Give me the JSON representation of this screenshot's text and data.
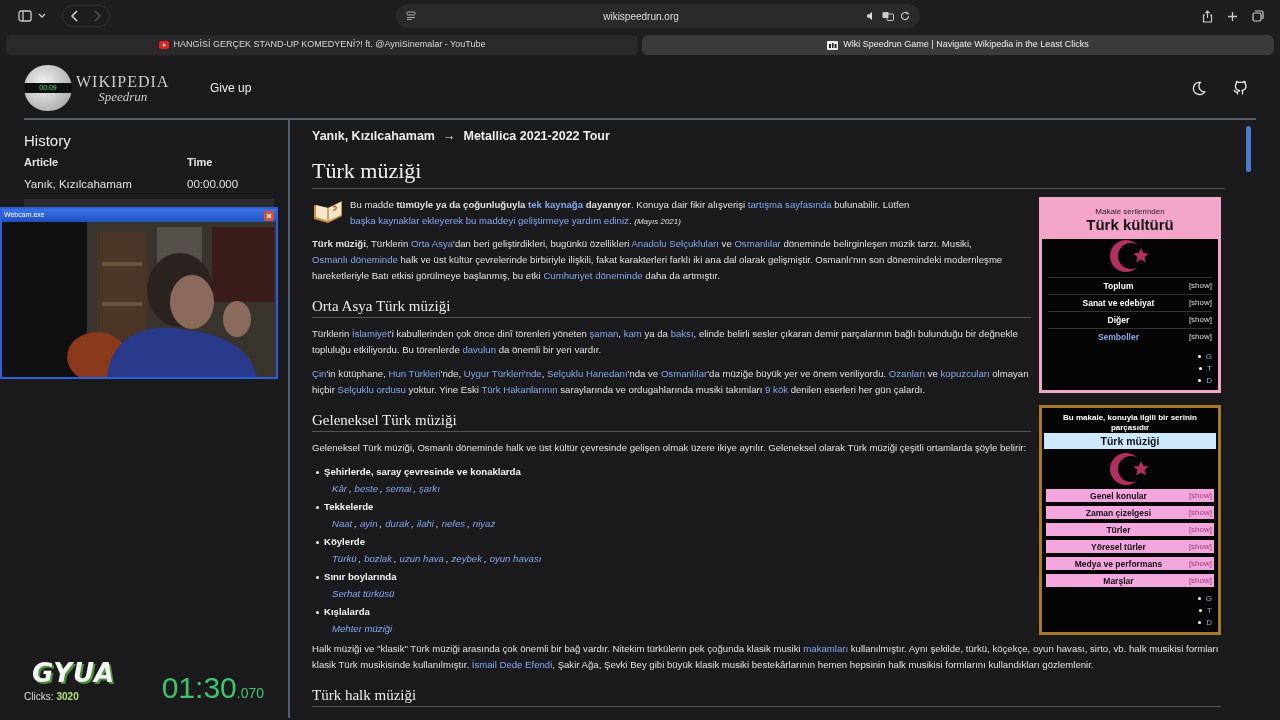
{
  "browser": {
    "url": "wikispeedrun.org",
    "tabs": [
      {
        "title": "HANGİSİ GERÇEK STAND-UP KOMEDYENİ?! ft. @AyniSinemalar - YouTube",
        "selected": false,
        "kind": "video"
      },
      {
        "title": "Wiki Speedrun Game | Navigate Wikipedia in the Least Clicks",
        "selected": true,
        "kind": "game"
      }
    ]
  },
  "header": {
    "logo_timer": "00:09",
    "logo_word": "WIKIPEDIA",
    "logo_sub": "Speedrun",
    "give_up": "Give up"
  },
  "history": {
    "title": "History",
    "columns": [
      "Article",
      "Time"
    ],
    "rows": [
      {
        "article": "Yanık, Kızılcahamam",
        "time": "00:00.000"
      }
    ]
  },
  "webcam": {
    "title": "Webcam.exe"
  },
  "player": {
    "name": "GYUA",
    "clicks_label": "Clicks:",
    "clicks": "3020",
    "timer": "01:30",
    "timer_ms": ".070"
  },
  "article": {
    "from": "Yanık, Kızılcahamam",
    "arrow": "→",
    "to": "Metallica 2021-2022 Tour",
    "title": "Türk müziği",
    "notice": {
      "segments": [
        {
          "kind": "text",
          "text": "Bu madde **tümüyle ya da çoğunluğuyla** "
        },
        {
          "kind": "link",
          "text": "**tek kaynağa**"
        },
        {
          "kind": "text",
          "text": " **dayanıyor**. Konuya dair fikir alışverişi "
        },
        {
          "kind": "link",
          "text": "tartışma sayfasında"
        },
        {
          "kind": "text",
          "text": " bulunabilir. Lütfen "
        },
        {
          "kind": "link",
          "text": "başka kaynaklar ekleyerek bu maddeyi geliştirmeye yardım ediniz"
        },
        {
          "kind": "text",
          "text": "."
        }
      ],
      "date": "(Mayıs 2021)"
    },
    "blocks": [
      {
        "kind": "p",
        "segments": [
          {
            "kind": "text",
            "text": "**Türk müziği**, Türklerin "
          },
          {
            "kind": "link",
            "text": "Orta Asya"
          },
          {
            "kind": "text",
            "text": "'dan beri geliştirdikleri, bugünkü özellikleri "
          },
          {
            "kind": "link",
            "text": "Anadolu Selçukluları"
          },
          {
            "kind": "text",
            "text": " ve "
          },
          {
            "kind": "link",
            "text": "Osmanlılar"
          },
          {
            "kind": "text",
            "text": " döneminde belirginleşen müzik tarzı. Musiki, "
          },
          {
            "kind": "link",
            "text": "Osmanlı döneminde"
          },
          {
            "kind": "text",
            "text": " halk ve üst kültür çevrelerinde birbiriyle ilişkili, fakat karakterleri farklı iki ana dal olarak gelişmiştir. Osmanlı'nın son dönemindeki modernleşme hareketleriyle Batı etkisi görülmeye başlanmış, bu etki "
          },
          {
            "kind": "link",
            "text": "Cumhuriyet döneminde"
          },
          {
            "kind": "text",
            "text": " daha da artmıştır."
          }
        ]
      },
      {
        "kind": "h2",
        "text": "Orta Asya Türk müziği"
      },
      {
        "kind": "p",
        "segments": [
          {
            "kind": "text",
            "text": "Türklerin "
          },
          {
            "kind": "link",
            "text": "İslamiyet"
          },
          {
            "kind": "text",
            "text": "'i kabullerinden çok önce dinî törenleri yöneten "
          },
          {
            "kind": "link",
            "text": "şaman"
          },
          {
            "kind": "text",
            "text": ", "
          },
          {
            "kind": "link",
            "text": "kam"
          },
          {
            "kind": "text",
            "text": " ya da "
          },
          {
            "kind": "link",
            "text": "baksı"
          },
          {
            "kind": "text",
            "text": ", elinde belirli sesler çıkaran demir parçalarının bağlı bulunduğu bir değnekle topluluğu etkiliyordu. Bu törenlerde "
          },
          {
            "kind": "link",
            "text": "davulun"
          },
          {
            "kind": "text",
            "text": " da önemli bir yeri vardır."
          }
        ]
      },
      {
        "kind": "p",
        "segments": [
          {
            "kind": "link",
            "text": "Çin"
          },
          {
            "kind": "text",
            "text": "'in kütüphane, "
          },
          {
            "kind": "link",
            "text": "Hun Türkleri"
          },
          {
            "kind": "text",
            "text": "'nde, "
          },
          {
            "kind": "link",
            "text": "Uygur Türkleri'nde"
          },
          {
            "kind": "text",
            "text": ", "
          },
          {
            "kind": "link",
            "text": "Selçuklu Hanedanı"
          },
          {
            "kind": "text",
            "text": "'nda ve "
          },
          {
            "kind": "link",
            "text": "Osmanlılar"
          },
          {
            "kind": "text",
            "text": "'da müziğe büyük yer ve önem veriliyordu. "
          },
          {
            "kind": "link",
            "text": "Ozanları"
          },
          {
            "kind": "text",
            "text": " ve "
          },
          {
            "kind": "link",
            "text": "kopuzcuları"
          },
          {
            "kind": "text",
            "text": " olmayan hiçbir "
          },
          {
            "kind": "link",
            "text": "Selçuklu ordusu"
          },
          {
            "kind": "text",
            "text": " yoktur. Yine Eski "
          },
          {
            "kind": "link",
            "text": "Türk Hakanlarının"
          },
          {
            "kind": "text",
            "text": " saraylarında ve ordugahlarında musiki takımları "
          },
          {
            "kind": "link",
            "text": "9 kök"
          },
          {
            "kind": "text",
            "text": " denilen eserleri her gün çalardı."
          }
        ]
      },
      {
        "kind": "h2",
        "text": "Geleneksel Türk müziği"
      },
      {
        "kind": "p",
        "segments": [
          {
            "kind": "text",
            "text": "Geleneksel Türk müziği, Osmanlı döneminde halk ve üst kültür çevresinde gelişen olmak üzere ikiye ayrılır. Geleneksel olarak Türk müziği çeşitli ortamlarda şöyle belirir:"
          }
        ]
      },
      {
        "kind": "list",
        "separator": ",",
        "items": [
          {
            "term": "Şehirlerde, saray çevresinde ve konaklarda",
            "links": [
              "Kâr",
              "beste",
              "semai",
              "şarkı"
            ]
          },
          {
            "term": "Tekkelerde",
            "links": [
              "Naat",
              "ayin",
              "durak",
              "ilahi",
              "nefes",
              "niyaz"
            ]
          },
          {
            "term": "Köylerde",
            "links": [
              "Türkü",
              "bozlak",
              "uzun hava",
              "zeybek",
              "oyun havası"
            ]
          },
          {
            "term": "Sınır boylarında",
            "links": [
              "Serhat türküsü"
            ]
          },
          {
            "term": "Kışlalarda",
            "links": [
              "Mehter müziği"
            ]
          }
        ]
      },
      {
        "kind": "p",
        "segments": [
          {
            "kind": "text",
            "text": "Halk müziği ve \"klasik\" Türk müziği arasında çok önemli bir bağ vardır. Nitekim türkülerin pek çoğunda klasik musiki "
          },
          {
            "kind": "link",
            "text": "makamları"
          },
          {
            "kind": "text",
            "text": " kullanılmıştır. Aynı şekilde, türkü, köçekçe, oyun havası, sirto, vb. halk musikisi formları klasik Türk musikisinde kullanılmıştır. "
          },
          {
            "kind": "link",
            "text": "İsmail Dede Efendi"
          },
          {
            "kind": "text",
            "text": ", Şakir Ağa, Şevki Bey gibi büyük klasik musiki bestekârlarının hemen hepsinin halk musikisi formlarını kullandıkları gözlemlenir."
          }
        ]
      },
      {
        "kind": "h2",
        "text": "Türk halk müziği"
      }
    ]
  },
  "infobox_culture": {
    "caption": "Makale serilerinden",
    "title": "Türk kültürü",
    "rows": [
      {
        "label": "Toplum",
        "show": "[show]",
        "link": false
      },
      {
        "label": "Sanat ve edebiyat",
        "show": "[show]",
        "link": false
      },
      {
        "label": "Diğer",
        "show": "[show]",
        "link": false
      },
      {
        "label": "Semboller",
        "show": "[show]",
        "link": true
      }
    ],
    "nav": [
      "G",
      "T",
      "D"
    ]
  },
  "infobox_music": {
    "caption": "Bu makale, konuyla ilgili bir serinin parçasıdır",
    "title": "Türk müziği",
    "rows": [
      {
        "label": "Genel konular",
        "show": "[show]"
      },
      {
        "label": "Zaman çizelgesi",
        "show": "[show]"
      },
      {
        "label": "Türler",
        "show": "[show]"
      },
      {
        "label": "Yöresel türler",
        "show": "[show]"
      },
      {
        "label": "Medya ve performans",
        "show": "[show]"
      },
      {
        "label": "Marşlar",
        "show": "[show]"
      }
    ],
    "nav": [
      "G",
      "T",
      "D"
    ]
  }
}
